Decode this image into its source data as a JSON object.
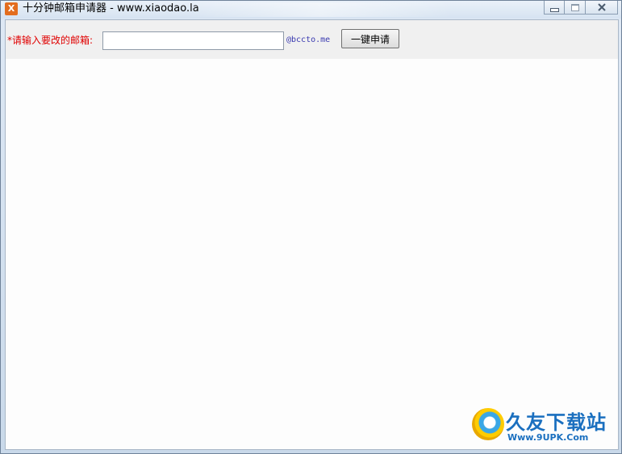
{
  "window": {
    "title": "十分钟邮箱申请器 - www.xiaodao.la",
    "app_icon_glyph": "X"
  },
  "form": {
    "label": "*请输入要改的邮箱:",
    "email_value": "",
    "email_placeholder": "",
    "domain_suffix": "@bccto.me",
    "apply_button_label": "一键申请"
  },
  "watermark": {
    "name": "久友下载站",
    "url": "Www.9UPK.Com"
  },
  "colors": {
    "label_red": "#e00000",
    "suffix_blue": "#3a3ab0",
    "brand_blue": "#1a6fbf"
  }
}
